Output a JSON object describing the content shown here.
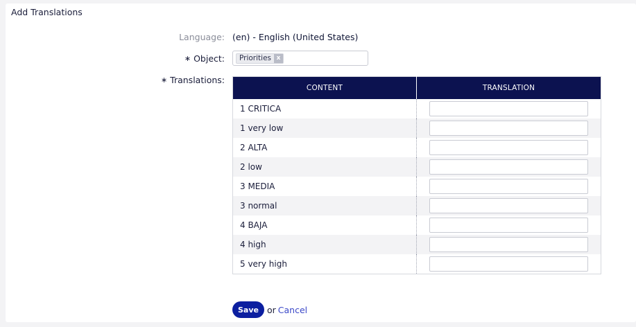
{
  "panel": {
    "title": "Add Translations"
  },
  "form": {
    "language_label": "Language:",
    "language_value": "(en) - English (United States)",
    "object_label": "Object:",
    "object_required_mark": "∗",
    "object_tags": [
      "Priorities"
    ],
    "tag_remove": "x",
    "translations_label": "Translations:",
    "translations_required_mark": "∗"
  },
  "table": {
    "headers": [
      "CONTENT",
      "TRANSLATION"
    ],
    "rows": [
      {
        "content": "1 CRITICA",
        "translation": ""
      },
      {
        "content": "1 very low",
        "translation": ""
      },
      {
        "content": "2 ALTA",
        "translation": ""
      },
      {
        "content": "2 low",
        "translation": ""
      },
      {
        "content": "3 MEDIA",
        "translation": ""
      },
      {
        "content": "3 normal",
        "translation": ""
      },
      {
        "content": "4 BAJA",
        "translation": ""
      },
      {
        "content": "4 high",
        "translation": ""
      },
      {
        "content": "5 very high",
        "translation": ""
      }
    ]
  },
  "actions": {
    "save_label": "Save",
    "or_text": "or",
    "cancel_label": "Cancel"
  },
  "colors": {
    "header_bg": "#0c1250",
    "save_bg": "#0c1fa0",
    "link": "#3b48c8"
  }
}
